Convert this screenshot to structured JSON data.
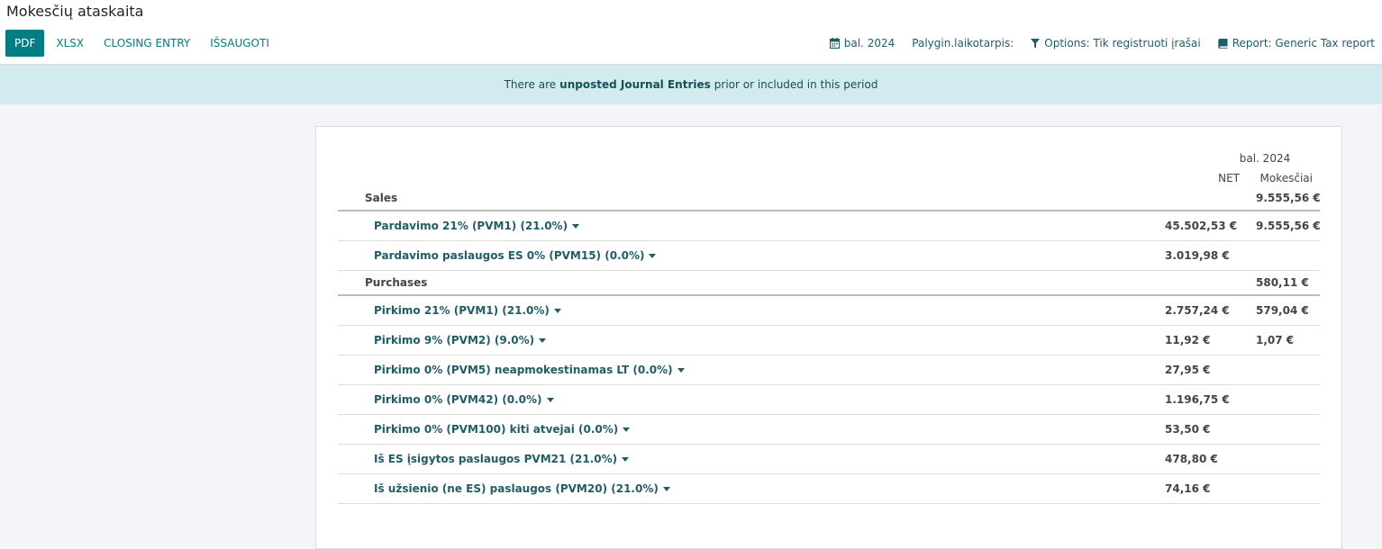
{
  "header": {
    "title": "Mokesčių ataskaita"
  },
  "toolbar": {
    "pdf_label": "PDF",
    "xlsx_label": "XLSX",
    "closing_entry_label": "CLOSING ENTRY",
    "save_label": "IŠSAUGOTI"
  },
  "filters": {
    "date": "bal. 2024",
    "comparison": "Palygin.laikotarpis:",
    "options": "Options: Tik registruoti įrašai",
    "report": "Report: Generic Tax report"
  },
  "alert": {
    "prefix": "There are",
    "link": "unposted Journal Entries",
    "suffix": "prior or included in this period"
  },
  "report": {
    "period": "bal. 2024",
    "col_net": "NET",
    "col_tax": "Mokesčiai",
    "sales": {
      "label": "Sales",
      "tax": "9.555,56 €",
      "lines": [
        {
          "label": "Pardavimo 21% (PVM1) (21.0%)",
          "net": "45.502,53 €",
          "tax": "9.555,56 €"
        },
        {
          "label": "Pardavimo paslaugos ES 0% (PVM15) (0.0%)",
          "net": "3.019,98 €",
          "tax": ""
        }
      ]
    },
    "purchases": {
      "label": "Purchases",
      "tax": "580,11 €",
      "lines": [
        {
          "label": "Pirkimo 21% (PVM1) (21.0%)",
          "net": "2.757,24 €",
          "tax": "579,04 €"
        },
        {
          "label": "Pirkimo 9% (PVM2) (9.0%)",
          "net": "11,92 €",
          "tax": "1,07 €"
        },
        {
          "label": "Pirkimo 0% (PVM5) neapmokestinamas LT (0.0%)",
          "net": "27,95 €",
          "tax": ""
        },
        {
          "label": "Pirkimo 0% (PVM42) (0.0%)",
          "net": "1.196,75 €",
          "tax": ""
        },
        {
          "label": "Pirkimo 0% (PVM100) kiti atvejai (0.0%)",
          "net": "53,50 €",
          "tax": ""
        },
        {
          "label": "Iš ES įsigytos paslaugos PVM21 (21.0%)",
          "net": "478,80 €",
          "tax": ""
        },
        {
          "label": "Iš užsienio (ne ES) paslaugos (PVM20) (21.0%)",
          "net": "74,16 €",
          "tax": ""
        }
      ]
    }
  },
  "colors": {
    "accent": "#017e84",
    "link": "#1f5d67",
    "alert_bg": "#d3ebee"
  }
}
